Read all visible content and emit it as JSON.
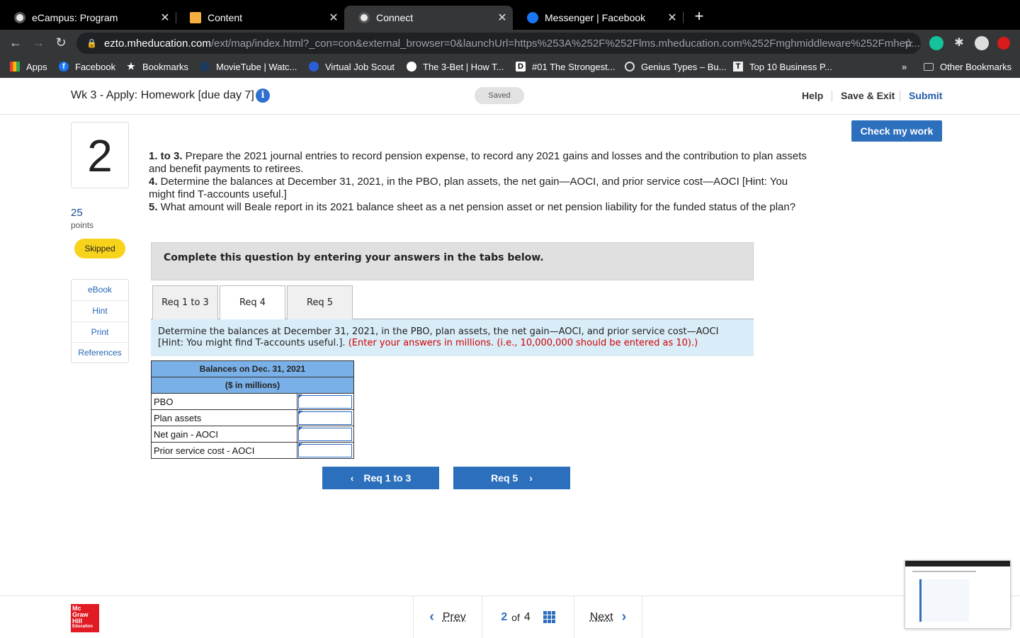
{
  "browser": {
    "tabs": [
      {
        "title": "eCampus: Program",
        "icon": "chrome-icon",
        "active": false
      },
      {
        "title": "Content",
        "icon": "pencil-icon",
        "active": false
      },
      {
        "title": "Connect",
        "icon": "chrome-icon",
        "active": true
      },
      {
        "title": "Messenger | Facebook",
        "icon": "facebook-icon",
        "active": false
      }
    ],
    "close_glyph": "✕",
    "new_tab_glyph": "+",
    "url_domain": "ezto.mheducation.com",
    "url_path": "/ext/map/index.html?_con=con&external_browser=0&launchUrl=https%253A%252F%252Flms.mheducation.com%252Fmghmiddleware%252Fmhep...",
    "bookmarks": [
      {
        "label": "Apps",
        "icon": "apps-icon"
      },
      {
        "label": "Facebook",
        "icon": "facebook-icon"
      },
      {
        "label": "Bookmarks",
        "icon": "star-icon"
      },
      {
        "label": "MovieTube | Watc...",
        "icon": "movietube-icon"
      },
      {
        "label": "Virtual Job Scout",
        "icon": "badge-icon"
      },
      {
        "label": "The 3-Bet | How T...",
        "icon": "poker-icon"
      },
      {
        "label": "#01 The Strongest...",
        "icon": "d-icon"
      },
      {
        "label": "Genius Types – Bu...",
        "icon": "globe-icon"
      },
      {
        "label": "Top 10 Business P...",
        "icon": "t-icon"
      }
    ],
    "overflow": "»",
    "other_bookmarks": "Other Bookmarks"
  },
  "header": {
    "title": "Wk 3 - Apply: Homework [due day 7]",
    "status": "Saved",
    "help": "Help",
    "save_exit": "Save & Exit",
    "submit": "Submit"
  },
  "question": {
    "number": "2",
    "points": "25",
    "points_label": "points",
    "status_badge": "Skipped",
    "resources": [
      "eBook",
      "Hint",
      "Print",
      "References"
    ],
    "check_button": "Check my work",
    "parts": [
      {
        "num": "1. to 3.",
        "text": " Prepare the 2021 journal entries to record pension expense, to record any 2021 gains and losses and the contribution to plan assets and benefit payments to retirees."
      },
      {
        "num": "4.",
        "text": " Determine the balances at December 31, 2021, in the PBO, plan assets, the net gain—AOCI, and prior service cost—AOCI [Hint: You might find T-accounts useful.]"
      },
      {
        "num": "5.",
        "text": " What amount will Beale report in its 2021 balance sheet as a net pension asset or net pension liability for the funded status of the plan?"
      }
    ],
    "instruction": "Complete this question by entering your answers in the tabs below.",
    "tabs": [
      "Req 1 to 3",
      "Req 4",
      "Req 5"
    ],
    "active_tab": "Req 4",
    "prompt_black": "Determine the balances at December 31, 2021, in the PBO, plan assets, the net gain—AOCI, and prior service cost—AOCI [Hint: You might find T-accounts useful.]. ",
    "prompt_red": "(Enter your answers in millions. (i.e., 10,000,000 should be entered as 10).)",
    "table": {
      "header1": "Balances on Dec. 31, 2021",
      "header2": "($ in millions)",
      "rows": [
        {
          "label": "PBO",
          "value": ""
        },
        {
          "label": "Plan assets",
          "value": ""
        },
        {
          "label": "Net gain - AOCI",
          "value": ""
        },
        {
          "label": "Prior service cost - AOCI",
          "value": ""
        }
      ]
    },
    "prev_req": "Req 1 to 3",
    "next_req": "Req 5"
  },
  "footer": {
    "logo_lines": [
      "Mc",
      "Graw",
      "Hill",
      "Education"
    ],
    "prev": "Prev",
    "current": "2",
    "of": "of",
    "total": "4",
    "next": "Next"
  },
  "colors": {
    "accent": "#2c6fbd",
    "badge_skipped": "#f8d31c",
    "table_header": "#7ab0e8",
    "prompt_bg": "#d9edf8",
    "logo_red": "#e21a23"
  }
}
